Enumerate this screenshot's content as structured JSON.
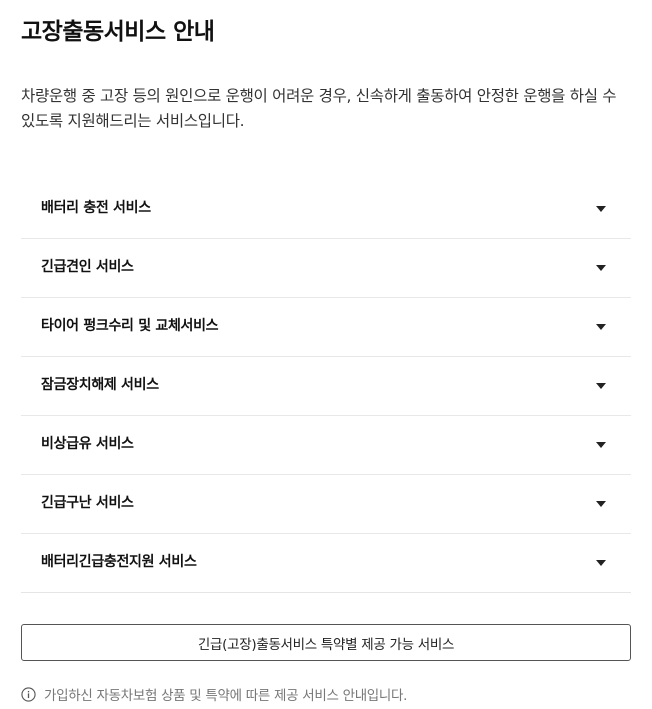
{
  "header": {
    "title": "고장출동서비스 안내"
  },
  "intro": {
    "text": "차량운행 중 고장 등의 원인으로 운행이 어려운 경우, 신속하게 출동하여 안정한 운행을 하실 수 있도록 지원해드리는 서비스입니다."
  },
  "services": {
    "items": [
      {
        "label": "배터리 충전 서비스",
        "icon": "chevron-down-icon"
      },
      {
        "label": "긴급견인 서비스",
        "icon": "chevron-down-icon"
      },
      {
        "label": "타이어 펑크수리 및 교체서비스",
        "icon": "chevron-down-icon"
      },
      {
        "label": "잠금장치해제 서비스",
        "icon": "chevron-down-icon"
      },
      {
        "label": "비상급유 서비스",
        "icon": "chevron-down-icon"
      },
      {
        "label": "긴급구난 서비스",
        "icon": "chevron-down-icon"
      },
      {
        "label": "배터리긴급충전지원 서비스",
        "icon": "chevron-down-icon"
      }
    ]
  },
  "actions": {
    "special_terms_button": "긴급(고장)출동서비스 특약별 제공 가능 서비스"
  },
  "footer_notice": {
    "icon": "info-icon",
    "text": "가입하신 자동차보험 상품 및 특약에 따른 제공 서비스 안내입니다."
  },
  "colors": {
    "text_primary": "#111111",
    "text_secondary": "#777777",
    "divider": "#e8e8e8",
    "button_border": "#555555"
  }
}
